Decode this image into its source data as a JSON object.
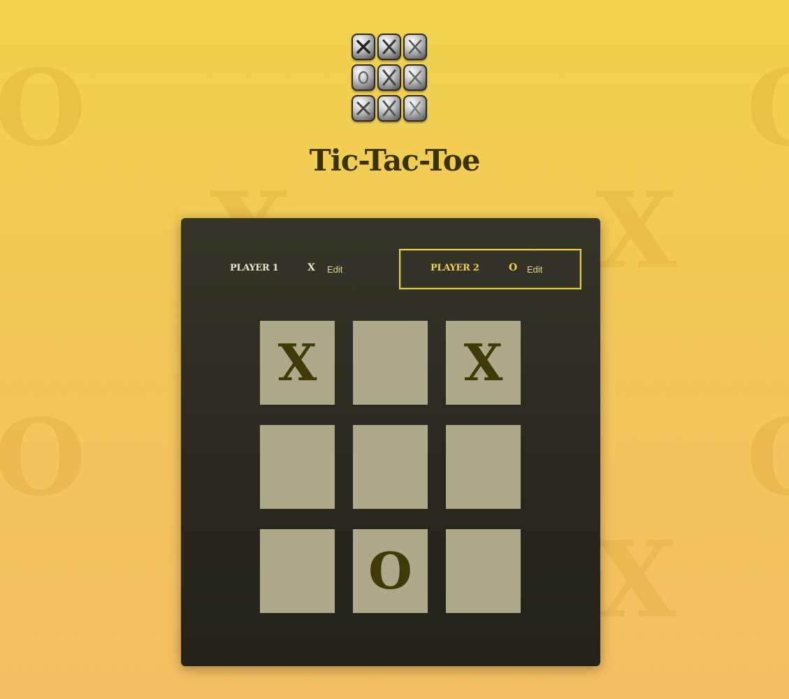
{
  "app": {
    "title": "Tic-Tac-Toe",
    "logo_icon": "tic-tac-toe-logo"
  },
  "players": [
    {
      "name": "PLAYER 1",
      "symbol": "X",
      "edit_label": "Edit",
      "active": false
    },
    {
      "name": "PLAYER 2",
      "symbol": "O",
      "edit_label": "Edit",
      "active": true
    }
  ],
  "board": {
    "cells": [
      "X",
      "",
      "X",
      "",
      "",
      "",
      "",
      "O",
      ""
    ]
  },
  "colors": {
    "background": "#f2d24c",
    "panel": "#2f2e23",
    "cell": "#aea98a",
    "mark": "#3f3b06",
    "active_border": "#e3cd45",
    "title": "#3b3308"
  }
}
